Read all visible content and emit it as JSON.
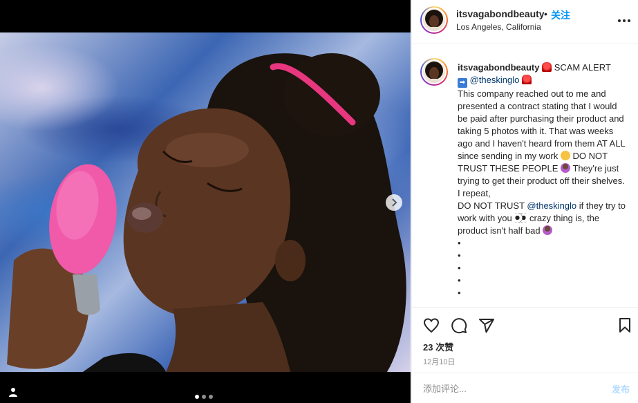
{
  "header": {
    "username": "itsvagabondbeauty",
    "separator": "•",
    "follow_label": "关注",
    "location": "Los Angeles, California"
  },
  "caption": {
    "username": "itsvagabondbeauty",
    "seg1": " SCAM ALERT ",
    "mention1": "@theskinglo",
    "seg2": "This company reached out to me and presented a contract stating that I would be paid after purchasing their product and taking 5 photos with it. That was weeks ago and I haven't heard from them AT ALL since sending in my work ",
    "seg3": " DO NOT TRUST THESE PEOPLE ",
    "seg4": " They're just trying to get their product off their shelves. I repeat,",
    "seg5": "DO NOT TRUST ",
    "mention2": "@theskinglo",
    "seg6": " if they try to work with you ",
    "seg7": " crazy thing is, the product isn't half bad ",
    "bullets": [
      "•",
      "•",
      "•",
      "•",
      "•"
    ]
  },
  "actions": {
    "icons": [
      "heart-icon",
      "comment-icon",
      "share-icon",
      "bookmark-icon"
    ],
    "likes": "23 次赞",
    "date": "12月10日"
  },
  "comment": {
    "placeholder": "添加评论...",
    "post_label": "发布"
  },
  "carousel": {
    "current_index": 1,
    "total": 3
  },
  "colors": {
    "accent": "#0095f6",
    "mention": "#00376b",
    "post_disabled": "#b3dbff",
    "headband": "#e8367f",
    "device": "#f05aa8"
  }
}
